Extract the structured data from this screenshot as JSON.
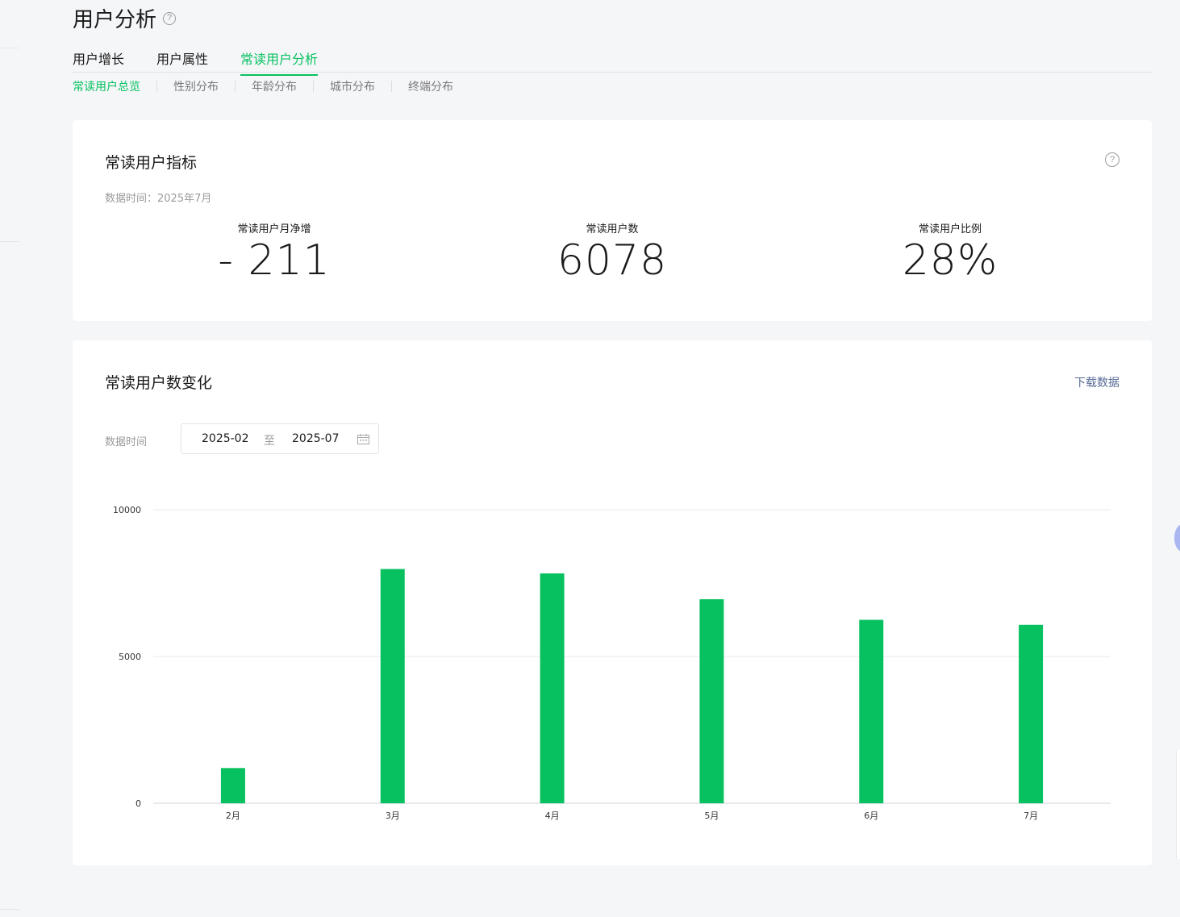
{
  "page": {
    "title": "用户分析"
  },
  "tabs": [
    {
      "label": "用户增长",
      "active": false
    },
    {
      "label": "用户属性",
      "active": false
    },
    {
      "label": "常读用户分析",
      "active": true
    }
  ],
  "subtabs": [
    {
      "label": "常读用户总览",
      "active": true
    },
    {
      "label": "性别分布",
      "active": false
    },
    {
      "label": "年龄分布",
      "active": false
    },
    {
      "label": "城市分布",
      "active": false
    },
    {
      "label": "终端分布",
      "active": false
    }
  ],
  "metrics_card": {
    "title": "常读用户指标",
    "data_time": "数据时间：2025年7月",
    "stats": [
      {
        "label": "常读用户月净增",
        "value": "- 211"
      },
      {
        "label": "常读用户数",
        "value": "6078"
      },
      {
        "label": "常读用户比例",
        "value": "28%"
      }
    ]
  },
  "trend_card": {
    "title": "常读用户数变化",
    "download_label": "下载数据",
    "date_label": "数据时间",
    "date_start": "2025-02",
    "date_separator": "至",
    "date_end": "2025-07"
  },
  "colors": {
    "accent": "#07c160",
    "link": "#576b95"
  },
  "chart_data": {
    "type": "bar",
    "categories": [
      "2月",
      "3月",
      "4月",
      "5月",
      "6月",
      "7月"
    ],
    "series": [
      {
        "values": [
          1200,
          7980,
          7830,
          6950,
          6250,
          6078
        ]
      }
    ],
    "ylim": [
      0,
      10000
    ],
    "yticks": [
      "0",
      "5000",
      "10000"
    ],
    "grid": true,
    "color": "#07c160"
  }
}
